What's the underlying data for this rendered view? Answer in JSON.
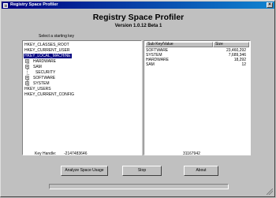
{
  "window": {
    "title": "Registry Space Profiler",
    "close_glyph": "×"
  },
  "header": {
    "title": "Registry Space Profiler",
    "version": "Version 1.0.12 Beta 1"
  },
  "tree": {
    "prompt": "Select a starting key",
    "roots": [
      {
        "label": "HKEY_CLASSES_ROOT"
      },
      {
        "label": "HKEY_CURRENT_USER"
      },
      {
        "label": "HKEY_LOCAL_MACHINE",
        "selected": true,
        "expander": "−",
        "children": [
          {
            "label": "HARDWARE",
            "expander": "+"
          },
          {
            "label": "SAM",
            "expander": "+"
          },
          {
            "label": "SECURITY"
          },
          {
            "label": "SOFTWARE",
            "expander": "+"
          },
          {
            "label": "SYSTEM",
            "expander": "+"
          }
        ]
      },
      {
        "label": "HKEY_USERS"
      },
      {
        "label": "HKEY_CURRENT_CONFIG"
      }
    ]
  },
  "list": {
    "columns": [
      "Sub Key/Value",
      "Size"
    ],
    "rows": [
      {
        "name": "SOFTWARE",
        "size": "23,460,292"
      },
      {
        "name": "SYSTEM",
        "size": "7,689,346"
      },
      {
        "name": "HARDWARE",
        "size": "18,292"
      },
      {
        "name": "SAM",
        "size": "12"
      }
    ]
  },
  "info": {
    "key_handle_label": "Key Handle:",
    "key_handle_value": "-2147483646",
    "total_value": "31167942"
  },
  "buttons": {
    "analyze": "Analyze Space Usage",
    "stop": "Stop",
    "about": "About"
  },
  "progress": {
    "fraction": 0.0
  },
  "colors": {
    "titlebar_start": "#000080",
    "titlebar_end": "#1084d0",
    "selection": "#000080"
  }
}
